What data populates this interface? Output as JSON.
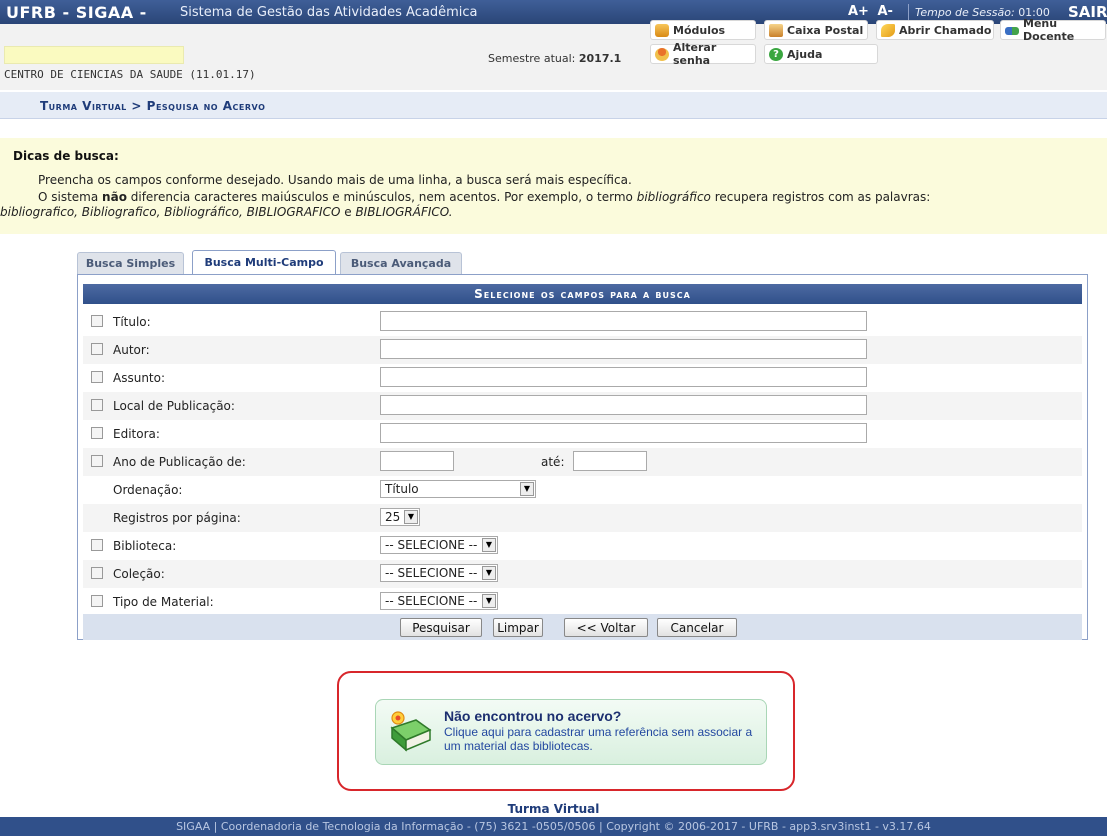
{
  "topbar": {
    "brand": "UFRB - SIGAA -",
    "subtitle": "Sistema de Gestão das Atividades Acadêmica",
    "font_increase": "A+",
    "font_decrease": "A-",
    "session_label": "Tempo de Sessão:",
    "session_time": "01:00",
    "logout": "SAIR"
  },
  "info": {
    "unit": "CENTRO DE CIENCIAS DA SAUDE (11.01.17)",
    "semester_label": "Semestre atual:",
    "semester_value": "2017.1",
    "buttons": {
      "modulos": "Módulos",
      "caixa_postal": "Caixa Postal",
      "abrir_chamado": "Abrir Chamado",
      "menu_docente": "Menu Docente",
      "alterar_senha": "Alterar senha",
      "ajuda": "Ajuda"
    }
  },
  "breadcrumb": "Turma Virtual > Pesquisa no Acervo",
  "tips": {
    "heading": "Dicas de busca:",
    "line1": "Preencha os campos conforme desejado. Usando mais de uma linha, a busca será mais específica.",
    "line2_a": "O sistema ",
    "line2_b": "não",
    "line2_c": " diferencia caracteres maiúsculos e minúsculos, nem acentos. Por exemplo, o termo ",
    "line2_d": "bibliográfico",
    "line2_e": " recupera registros com as palavras:",
    "line3_a": "bibliografico, Bibliografico, Bibliográfico, BIBLIOGRAFICO",
    "line3_b": " e ",
    "line3_c": "BIBLIOGRÁFICO."
  },
  "tabs": [
    {
      "label": "Busca Simples",
      "active": false
    },
    {
      "label": "Busca Multi-Campo",
      "active": true
    },
    {
      "label": "Busca Avançada",
      "active": false
    }
  ],
  "form": {
    "header": "Selecione os campos para a busca",
    "fields": {
      "titulo": {
        "label": "Título:",
        "value": ""
      },
      "autor": {
        "label": "Autor:",
        "value": ""
      },
      "assunto": {
        "label": "Assunto:",
        "value": ""
      },
      "local": {
        "label": "Local de Publicação:",
        "value": ""
      },
      "editora": {
        "label": "Editora:",
        "value": ""
      },
      "ano": {
        "label": "Ano de Publicação de:",
        "ate_label": "até:",
        "from": "",
        "to": ""
      },
      "ordenacao": {
        "label": "Ordenação:",
        "value": "Título"
      },
      "registros": {
        "label": "Registros por página:",
        "value": "25"
      },
      "biblioteca": {
        "label": "Biblioteca:",
        "value": "-- SELECIONE --"
      },
      "colecao": {
        "label": "Coleção:",
        "value": "-- SELECIONE --"
      },
      "tipo": {
        "label": "Tipo de Material:",
        "value": "-- SELECIONE --"
      }
    },
    "buttons": {
      "pesquisar": "Pesquisar",
      "limpar": "Limpar",
      "voltar": "<< Voltar",
      "cancelar": "Cancelar"
    }
  },
  "callout": {
    "title": "Não encontrou no acervo?",
    "subtitle": "Clique aqui para cadastrar uma referência sem associar a um material das bibliotecas."
  },
  "footer": {
    "link": "Turma Virtual",
    "text": "SIGAA | Coordenadoria de Tecnologia da Informação - (75) 3621 -0505/0506 | Copyright © 2006-2017 - UFRB - app3.srv3inst1 - v3.17.64"
  },
  "colors": {
    "header_blue": "#2a4577",
    "tips_bg": "#fbfbdc",
    "highlight_red": "#d8262b"
  }
}
